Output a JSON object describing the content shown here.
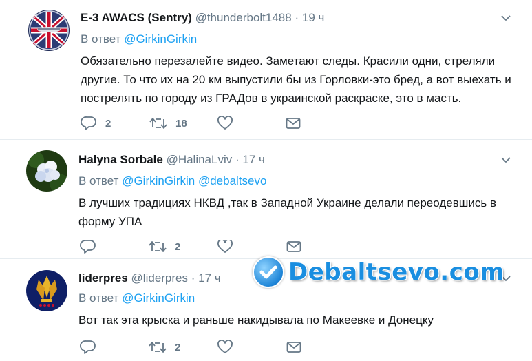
{
  "tweets": [
    {
      "name": "E-3 AWACS (Sentry)",
      "handle": "@thunderbolt1488",
      "time": "19 ч",
      "reply_prefix": "В ответ",
      "mentions": [
        "@GirkinGirkin"
      ],
      "text": "Обязательно перезалейте видео. Заметают следы. Красили одни, стреляли другие. То что их на 20 км выпустили бы из Горловки-это бред, а вот выехать и пострелять по городу из ГРАДов в украинской раскраске, это в масть.",
      "replies": "2",
      "retweets": "18"
    },
    {
      "name": "Halyna Sorbale",
      "handle": "@HalinaLviv",
      "time": "17 ч",
      "reply_prefix": "В ответ",
      "mentions": [
        "@GirkinGirkin",
        "@debaltsevo"
      ],
      "text": "В лучших традициях НКВД ,так в Западной Украине делали переодевшись в форму УПА",
      "replies": "",
      "retweets": "2"
    },
    {
      "name": "liderpres",
      "handle": "@liderpres",
      "time": "17 ч",
      "reply_prefix": "В ответ",
      "mentions": [
        "@GirkinGirkin"
      ],
      "text": "Вот так эта крыска и раньше накидывала по Макеевке и Донецку",
      "replies": "",
      "retweets": "2"
    }
  ],
  "separator": "·",
  "watermark": "Debaltsevo.com",
  "colors": {
    "link": "#1da1f2",
    "secondary": "#657786",
    "text": "#14171a",
    "divider": "#e6ecf0",
    "watermark": "#1a8ee0"
  },
  "icons": [
    "reply-icon",
    "retweet-icon",
    "like-icon",
    "direct-message-icon",
    "chevron-down-icon"
  ]
}
